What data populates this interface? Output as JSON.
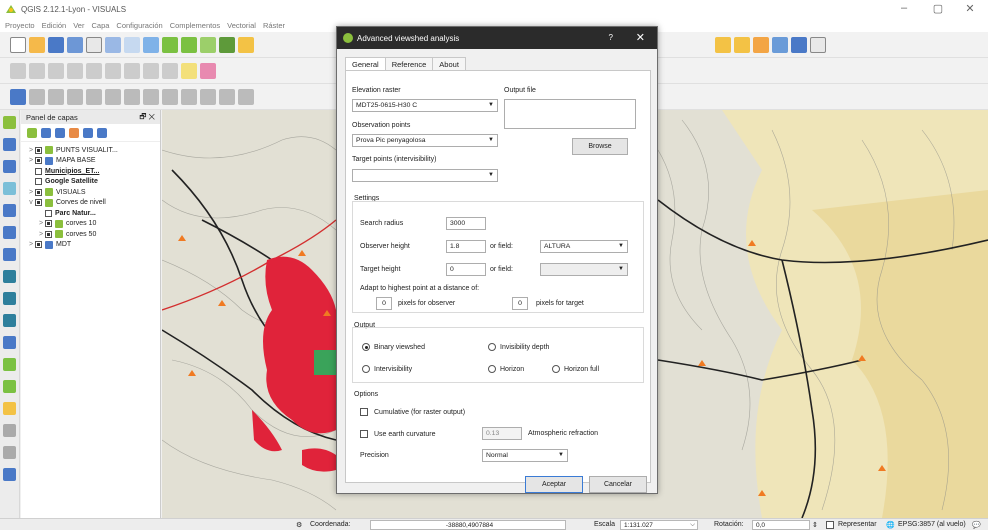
{
  "window": {
    "title": "QGIS 2.12.1-Lyon - VISUALS"
  },
  "menu": [
    "Proyecto",
    "Edición",
    "Ver",
    "Capa",
    "Configuración",
    "Complementos",
    "Vectorial",
    "Ráster"
  ],
  "layers_panel": {
    "title": "Panel de capas",
    "items": [
      {
        "label": "PUNTS VISUALIT...",
        "checked": true,
        "expand": ">",
        "indent": 0,
        "style": ""
      },
      {
        "label": "MAPA BASE",
        "checked": true,
        "expand": ">",
        "indent": 0,
        "style": ""
      },
      {
        "label": "Municipios_ET...",
        "checked": false,
        "expand": "",
        "indent": 0,
        "style": "bold underline"
      },
      {
        "label": "Google Satellite",
        "checked": false,
        "expand": "",
        "indent": 0,
        "style": "bold"
      },
      {
        "label": "VISUALS",
        "checked": true,
        "expand": ">",
        "indent": 0,
        "style": ""
      },
      {
        "label": "Corves de nivell",
        "checked": true,
        "expand": "v",
        "indent": 0,
        "style": ""
      },
      {
        "label": "Parc Natur...",
        "checked": false,
        "expand": "",
        "indent": 1,
        "style": "bold"
      },
      {
        "label": "corves 10",
        "checked": true,
        "expand": ">",
        "indent": 1,
        "style": ""
      },
      {
        "label": "corves 50",
        "checked": true,
        "expand": ">",
        "indent": 1,
        "style": ""
      },
      {
        "label": "MDT",
        "checked": true,
        "expand": ">",
        "indent": 0,
        "style": ""
      }
    ]
  },
  "dialog": {
    "title": "Advanced viewshed analysis",
    "help": "?",
    "close": "✕",
    "tabs": [
      "General",
      "Reference",
      "About"
    ],
    "elevation_raster_label": "Elevation raster",
    "elevation_raster_value": "MDT25-0615-H30 C",
    "output_file_label": "Output file",
    "output_file_value": "",
    "observation_points_label": "Observation points",
    "observation_points_value": "Prova Pic penyagolosa",
    "browse_label": "Browse",
    "target_points_label": "Target points (intervisibility)",
    "target_points_value": "",
    "settings": {
      "title": "Settings",
      "search_radius_label": "Search radius",
      "search_radius_value": "3000",
      "observer_height_label": "Observer height",
      "observer_height_value": "1.8",
      "or_field_label": "or field:",
      "observer_field_value": "ALTURA",
      "target_height_label": "Target height",
      "target_height_value": "0",
      "target_field_value": "",
      "adapt_label": "Adapt to highest point at a distance of:",
      "pixels_observer_value": "0",
      "pixels_observer_label": "pixels for observer",
      "pixels_target_value": "0",
      "pixels_target_label": "pixels for target"
    },
    "output": {
      "title": "Output",
      "binary": "Binary viewshed",
      "invisibility": "Invisibility depth",
      "intervisibility": "Intervisibility",
      "horizon": "Horizon",
      "horizon_full": "Horizon full",
      "selected": "binary"
    },
    "options": {
      "title": "Options",
      "cumulative": "Cumulative (for raster output)",
      "earth_curvature": "Use earth curvature",
      "refraction_value": "0.13",
      "refraction_label": "Atmospheric refraction",
      "precision_label": "Precision",
      "precision_value": "Normal"
    },
    "ok_label": "Aceptar",
    "cancel_label": "Cancelar"
  },
  "statusbar": {
    "coord_label": "Coordenada:",
    "coord_value": "-38880,4907884",
    "scale_label": "Escala",
    "scale_value": "1:131.027",
    "rotation_label": "Rotación:",
    "rotation_value": "0,0",
    "render_label": "Representar",
    "crs_label": "EPSG:3857 (al vuelo)"
  },
  "colors": {
    "dialog_title_bg": "#2b2b2b",
    "viewshed_red": "#e0233a",
    "viewshed_green": "#3aa35a",
    "point_orange": "#f07a22",
    "terrain_yellow": "#f5e7a8",
    "accent_green": "#8bbf3d"
  }
}
